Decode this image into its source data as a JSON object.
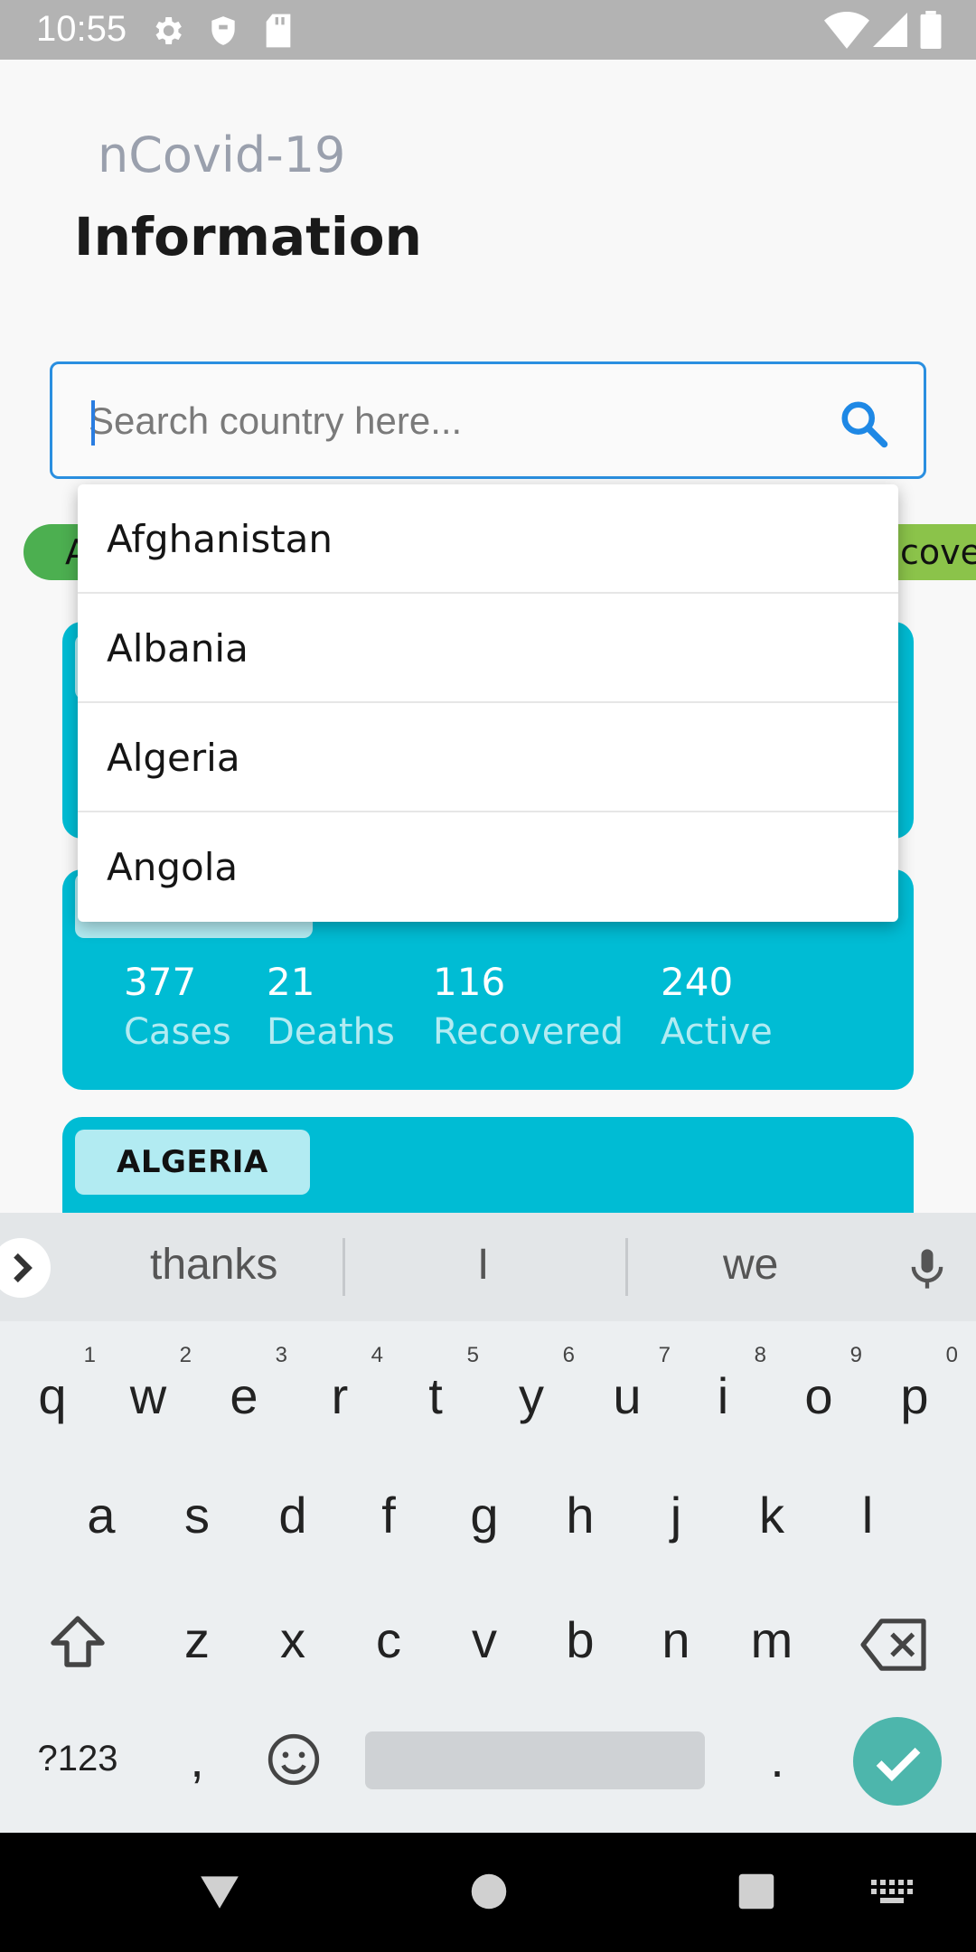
{
  "status_bar": {
    "time": "10:55",
    "icons_left": [
      "gear-icon",
      "shield-icon",
      "sd-card-icon"
    ],
    "icons_right": [
      "wifi-icon",
      "signal-icon",
      "battery-icon"
    ]
  },
  "header": {
    "app_title": "nCovid-19",
    "page_title": "Information"
  },
  "search": {
    "placeholder": "Search country here...",
    "value": "",
    "icon": "search-icon",
    "accent_color": "#2a8fe0"
  },
  "filter_chips": [
    {
      "label": "A"
    },
    {
      "label": "cove"
    }
  ],
  "dropdown": {
    "options": [
      "Afghanistan",
      "Albania",
      "Algeria",
      "Angola"
    ]
  },
  "cards": [
    {
      "country": "ALBANIA",
      "cases": "377",
      "deaths": "21",
      "recovered": "116",
      "active": "240"
    },
    {
      "country": "ALGERIA"
    }
  ],
  "card_labels": {
    "cases": "Cases",
    "deaths": "Deaths",
    "recovered": "Recovered",
    "active": "Active"
  },
  "keyboard": {
    "suggestions": [
      "thanks",
      "I",
      "we"
    ],
    "row1": [
      {
        "key": "q",
        "hint": "1"
      },
      {
        "key": "w",
        "hint": "2"
      },
      {
        "key": "e",
        "hint": "3"
      },
      {
        "key": "r",
        "hint": "4"
      },
      {
        "key": "t",
        "hint": "5"
      },
      {
        "key": "y",
        "hint": "6"
      },
      {
        "key": "u",
        "hint": "7"
      },
      {
        "key": "i",
        "hint": "8"
      },
      {
        "key": "o",
        "hint": "9"
      },
      {
        "key": "p",
        "hint": "0"
      }
    ],
    "row2": [
      "a",
      "s",
      "d",
      "f",
      "g",
      "h",
      "j",
      "k",
      "l"
    ],
    "row3": [
      "z",
      "x",
      "c",
      "v",
      "b",
      "n",
      "m"
    ],
    "symbols_key": "?123",
    "comma_key": ",",
    "period_key": ".",
    "enter_color": "#4db6ac"
  },
  "colors": {
    "card": "#00bcd4",
    "card_tag": "#b2ebf2",
    "chip_all": "#4caf50",
    "chip_recovered": "#8bc34a"
  }
}
